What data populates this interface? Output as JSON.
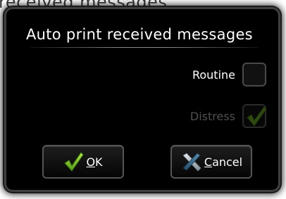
{
  "background": {
    "title_partial": "received messages"
  },
  "dialog": {
    "title": "Auto print received messages",
    "options": [
      {
        "label": "Routine",
        "checked": false,
        "enabled": true
      },
      {
        "label": "Distress",
        "checked": true,
        "enabled": false
      }
    ],
    "buttons": {
      "ok": {
        "mnemonic": "O",
        "rest": "K",
        "icon": "checkmark-icon"
      },
      "cancel": {
        "mnemonic": "C",
        "rest": "ancel",
        "icon": "cross-icon"
      }
    }
  },
  "colors": {
    "dialog_background": "#000000",
    "text": "#ffffff",
    "disabled_text": "#505050",
    "check_green": "#7fc31c"
  }
}
